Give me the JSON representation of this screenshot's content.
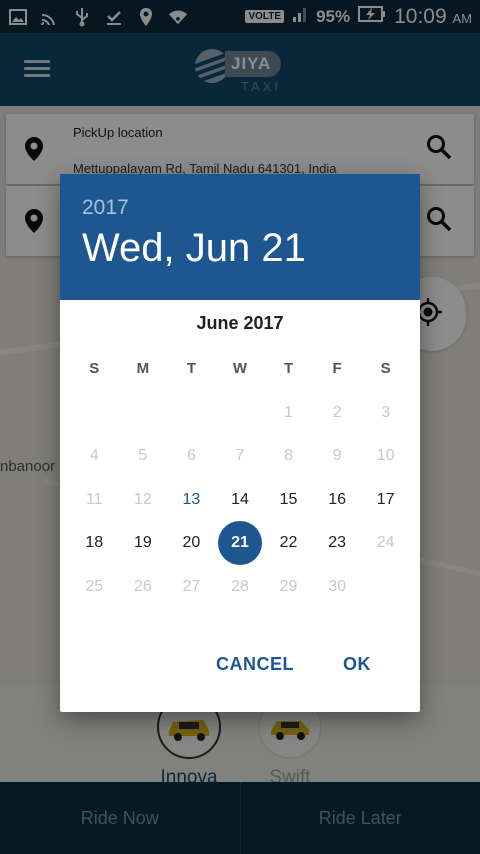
{
  "status_bar": {
    "network_label": "VOLTE",
    "battery": "95%",
    "time": "10:09",
    "ampm": "AM"
  },
  "app": {
    "logo_word": "JIYA",
    "logo_sub": "TAXI"
  },
  "pickup": {
    "title": "PickUp location",
    "value": "Mettuppalayam Rd, Tamil Nadu 641301, India"
  },
  "map": {
    "place_label": "nbanoor"
  },
  "cars": [
    {
      "label": "Innova"
    },
    {
      "label": "Swift"
    }
  ],
  "bottom": {
    "ride_now": "Ride Now",
    "ride_later": "Ride Later"
  },
  "dialog": {
    "year": "2017",
    "date": "Wed, Jun 21",
    "month_title": "June 2017",
    "weekdays": [
      "S",
      "M",
      "T",
      "W",
      "T",
      "F",
      "S"
    ],
    "weeks": [
      [
        "",
        "",
        "",
        "",
        "1",
        "2",
        "3"
      ],
      [
        "4",
        "5",
        "6",
        "7",
        "8",
        "9",
        "10"
      ],
      [
        "11",
        "12",
        "13",
        "14",
        "15",
        "16",
        "17"
      ],
      [
        "18",
        "19",
        "20",
        "21",
        "22",
        "23",
        "24"
      ],
      [
        "25",
        "26",
        "27",
        "28",
        "29",
        "30",
        ""
      ]
    ],
    "selected_day": "21",
    "today": "13",
    "cancel": "CANCEL",
    "ok": "OK"
  },
  "colors": {
    "primary": "#1e5690",
    "app_bar": "#0f4a6b",
    "status_bar": "#0c2b3e"
  }
}
